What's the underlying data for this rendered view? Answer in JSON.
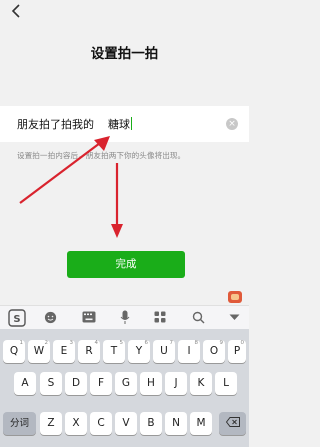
{
  "header": {
    "title": "设置拍一拍"
  },
  "input": {
    "prefix": "朋友拍了拍我的",
    "value": "糖球"
  },
  "hint": "设置拍一拍内容后，朋友拍两下你的头像将出现。",
  "done_label": "完成",
  "keyboard": {
    "row1": [
      "Q",
      "W",
      "E",
      "R",
      "T",
      "Y",
      "U",
      "I",
      "O",
      "P"
    ],
    "row1_hints": [
      "1",
      "2",
      "3",
      "4",
      "5",
      "6",
      "7",
      "8",
      "9",
      "0"
    ],
    "row2": [
      "A",
      "S",
      "D",
      "F",
      "G",
      "H",
      "J",
      "K",
      "L"
    ],
    "row3": [
      "Z",
      "X",
      "C",
      "V",
      "B",
      "N",
      "M"
    ],
    "fenci_label": "分词"
  }
}
